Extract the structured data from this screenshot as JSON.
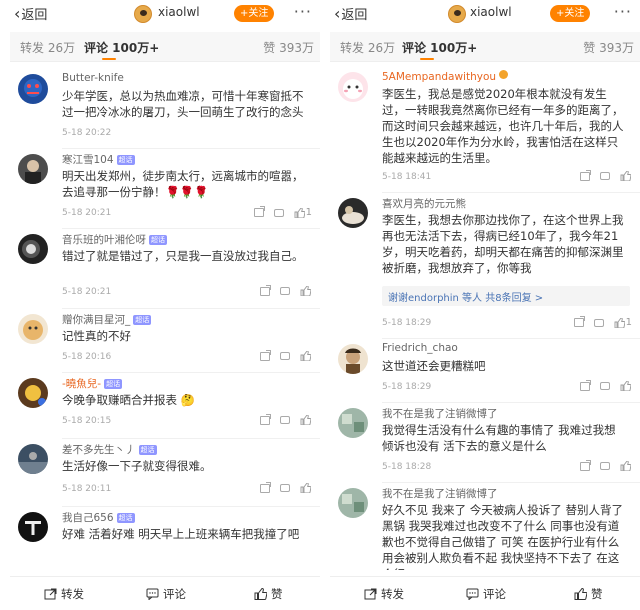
{
  "left": {
    "top": {
      "back_label": "返回",
      "username": "xiaolwl",
      "follow_label": "+关注",
      "more_label": "···"
    },
    "tabs": {
      "repost": "转发 26万",
      "comment": "评论 100万+",
      "like": "赞 393万"
    },
    "comments": [
      {
        "name": "Butter-knife",
        "badge": "",
        "text": "少年学医，总以为热血难凉，可惜十年寒窗抵不过一把冷冰冰的屠刀，头一回萌生了改行的念头",
        "time": "5-18 20:22",
        "likes": ""
      },
      {
        "name": "寒江雪104",
        "badge": "超话",
        "text": "明天出发郑州，徒步南太行，远离城市的喧嚣，去追寻那一份宁静！🌹🌹🌹",
        "time": "5-18 20:21",
        "likes": "1"
      },
      {
        "name": "音乐班的叶湘伦呀",
        "badge": "超话",
        "text": "错过了就是错过了，只是我一直没放过我自己。",
        "time": "5-18 20:21",
        "likes": ""
      },
      {
        "name": "赠你满目星河_",
        "badge": "超话",
        "text": "记性真的不好",
        "time": "5-18 20:16",
        "likes": ""
      },
      {
        "name": "-曉魚兒-",
        "badge": "超话",
        "text": "今晚争取赚晒合并报表 🤔",
        "time": "5-18 20:15",
        "likes": ""
      },
      {
        "name": "差不多先生丶丿",
        "badge": "超话",
        "text": "生活好像一下子就变得很难。",
        "time": "5-18 20:11",
        "likes": ""
      },
      {
        "name": "我自己656",
        "badge": "超话",
        "text": "好难  活着好难  明天早上上班来辆车把我撞了吧",
        "time": "",
        "likes": ""
      }
    ],
    "bottom": {
      "repost": "转发",
      "comment": "评论",
      "like": "赞"
    }
  },
  "right": {
    "top": {
      "back_label": "返回",
      "username": "xiaolwl",
      "follow_label": "+关注",
      "more_label": "···"
    },
    "tabs": {
      "repost": "转发 26万",
      "comment": "评论 100万+",
      "like": "赞 393万"
    },
    "comments": [
      {
        "name": "5AMempandawithyou",
        "badge": "",
        "text": "李医生，我总是感觉2020年根本就没有发生过，一转眼我竟然离你已经有一年多的距离了，而这时间只会越来越远，也许几十年后，我的人生也以2020年作为分水岭，我害怕活在这样只能越来越远的生活里。",
        "time": "5-18 18:41",
        "likes": ""
      },
      {
        "name": "喜欢月亮的元元熊",
        "badge": "",
        "text": "李医生，我想去你那边找你了，在这个世界上我再也无法活下去，得病已经10年了，我今年21岁，明天吃着药，却明天都在痛苦的抑郁深渊里被折磨，我想放弃了，你等我",
        "reply": "谢谢endorphin 等人  共8条回复 >",
        "time": "5-18 18:29",
        "likes": "1"
      },
      {
        "name": "Friedrich_chao",
        "badge": "",
        "text": "这世道还会更糟糕吧",
        "time": "5-18 18:29",
        "likes": ""
      },
      {
        "name": "我不在是我了注销微博了",
        "badge": "",
        "text": "我觉得生活没有什么有趣的事情了 我难过我想倾诉也没有 活下去的意义是什么",
        "time": "5-18 18:28",
        "likes": ""
      },
      {
        "name": "我不在是我了注销微博了",
        "badge": "",
        "text": "好久不见 我来了 今天被病人投诉了 替别人背了黑锅 我哭我难过也改变不了什么 同事也没有道歉也不觉得自己做错了 可笑 在医护行业有什么用会被别人欺负看不起 我快坚持不下去了 在这个行",
        "time": "",
        "likes": ""
      }
    ],
    "bottom": {
      "repost": "转发",
      "comment": "评论",
      "like": "赞"
    }
  },
  "colors": {
    "accent": "#ff8200",
    "link": "#4a74b5",
    "name_orange": "#e86722"
  }
}
